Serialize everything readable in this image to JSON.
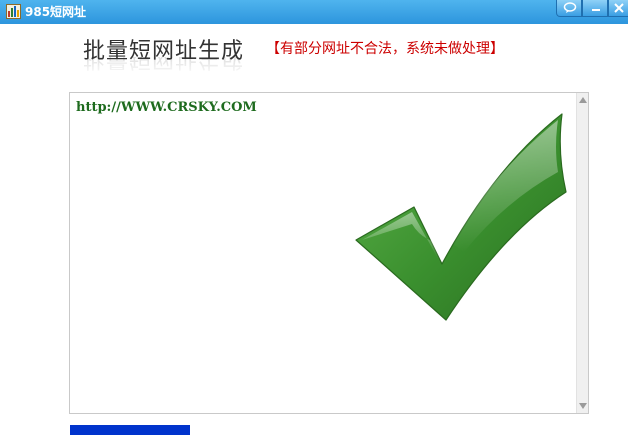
{
  "window": {
    "title": "985短网址"
  },
  "header": {
    "title": "批量短网址生成",
    "notice": "【有部分网址不合法，系统未做处理】"
  },
  "input": {
    "value": "http://WWW.CRSKY.COM"
  },
  "status": {
    "icon": "success-checkmark-icon",
    "color": "#3a8f2e"
  },
  "progress": {
    "fraction": 0.23,
    "color": "#0033cc"
  }
}
